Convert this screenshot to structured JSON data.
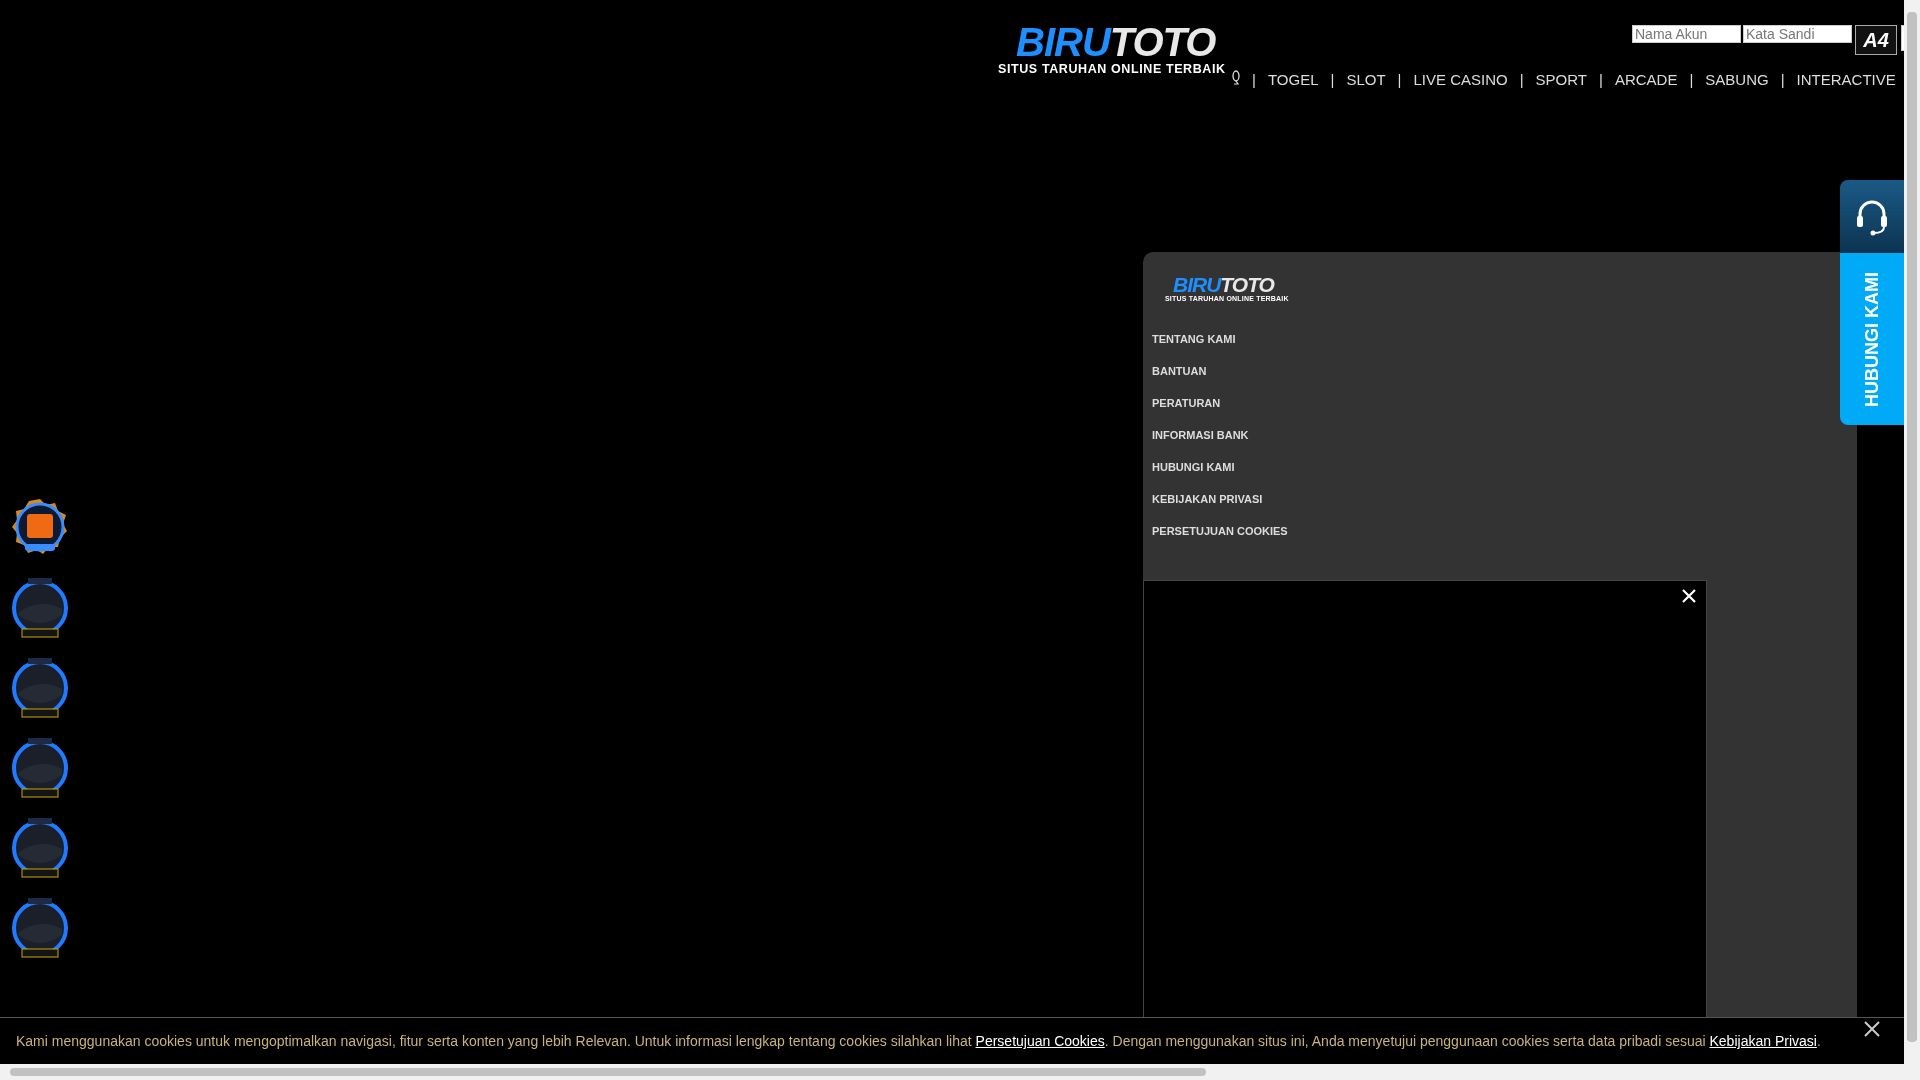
{
  "header": {
    "logo": {
      "brand_a": "BIRU",
      "brand_b": "TOTO",
      "tagline": "SITUS TARUHAN ONLINE TERBAIK"
    },
    "login": {
      "username": {
        "placeholder": "Nama Akun"
      },
      "password": {
        "placeholder": "Kata Sandi"
      },
      "captcha": "A4"
    },
    "nav": {
      "separator": "|",
      "items": [
        {
          "kind": "icon"
        },
        {
          "kind": "text",
          "label": "TOGEL"
        },
        {
          "kind": "text",
          "label": "SLOT"
        },
        {
          "kind": "text",
          "label": "LIVE CASINO"
        },
        {
          "kind": "text",
          "label": "SPORT"
        },
        {
          "kind": "text",
          "label": "ARCADE"
        },
        {
          "kind": "text",
          "label": "SABUNG"
        },
        {
          "kind": "text",
          "label": "INTERACTIVE"
        }
      ]
    }
  },
  "contact_widget": {
    "label": "HUBUNGI KAMI"
  },
  "side_badges": [
    {
      "kind": "featured"
    },
    {
      "kind": "plain"
    },
    {
      "kind": "plain"
    },
    {
      "kind": "plain"
    },
    {
      "kind": "plain"
    },
    {
      "kind": "plain"
    }
  ],
  "footer_panel": {
    "logo": {
      "brand_a": "BIRU",
      "brand_b": "TOTO",
      "tagline": "SITUS TARUHAN ONLINE TERBAIK"
    },
    "links": [
      "TENTANG KAMI",
      "BANTUAN",
      "PERATURAN",
      "INFORMASI BANK",
      "HUBUNGI KAMI",
      "KEBIJAKAN PRIVASI",
      "PERSETUJUAN COOKIES"
    ]
  },
  "cookie_bar": {
    "text_1": "Kami menggunakan cookies untuk mengoptimalkan navigasi, fitur serta konten yang lebih Relevan. Untuk informasi lengkap tentang cookies silahkan lihat ",
    "link_1": "Persetujuan Cookies",
    "text_2": ". Dengan menggunakan situs ini, Anda menyetujui penggunaan cookies serta data pribadi sesuai ",
    "link_2": "Kebijakan Privasi",
    "text_3": "."
  }
}
